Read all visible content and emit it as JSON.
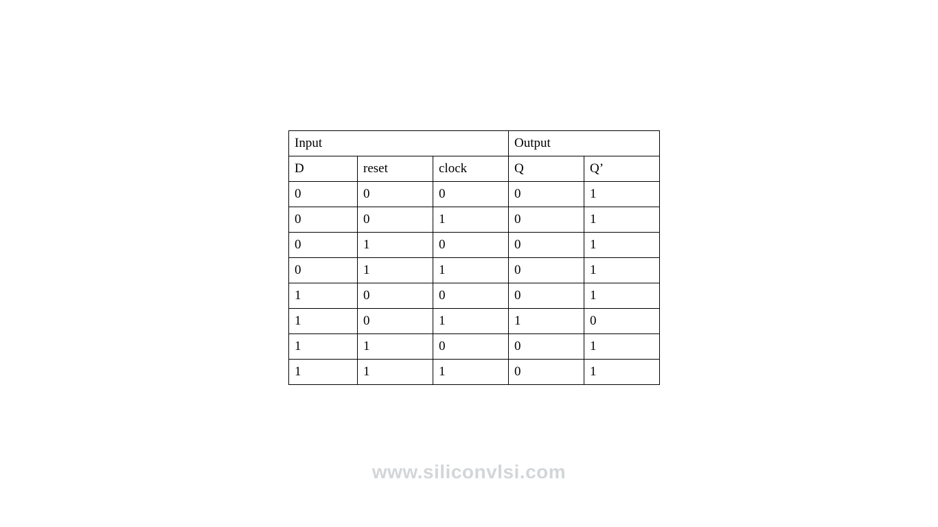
{
  "table": {
    "group_headers": {
      "input": "Input",
      "output": "Output"
    },
    "col_headers": {
      "d": "D",
      "reset": "reset",
      "clock": "clock",
      "q": "Q",
      "qbar": "Q’"
    },
    "rows": [
      {
        "d": "0",
        "reset": "0",
        "clock": "0",
        "q": "0",
        "qbar": "1"
      },
      {
        "d": "0",
        "reset": "0",
        "clock": "1",
        "q": "0",
        "qbar": "1"
      },
      {
        "d": "0",
        "reset": "1",
        "clock": "0",
        "q": "0",
        "qbar": "1"
      },
      {
        "d": "0",
        "reset": "1",
        "clock": "1",
        "q": "0",
        "qbar": "1"
      },
      {
        "d": "1",
        "reset": "0",
        "clock": "0",
        "q": "0",
        "qbar": "1"
      },
      {
        "d": "1",
        "reset": "0",
        "clock": "1",
        "q": "1",
        "qbar": "0"
      },
      {
        "d": "1",
        "reset": "1",
        "clock": "0",
        "q": "0",
        "qbar": "1"
      },
      {
        "d": "1",
        "reset": "1",
        "clock": "1",
        "q": "0",
        "qbar": "1"
      }
    ]
  },
  "watermark": "www.siliconvlsi.com"
}
